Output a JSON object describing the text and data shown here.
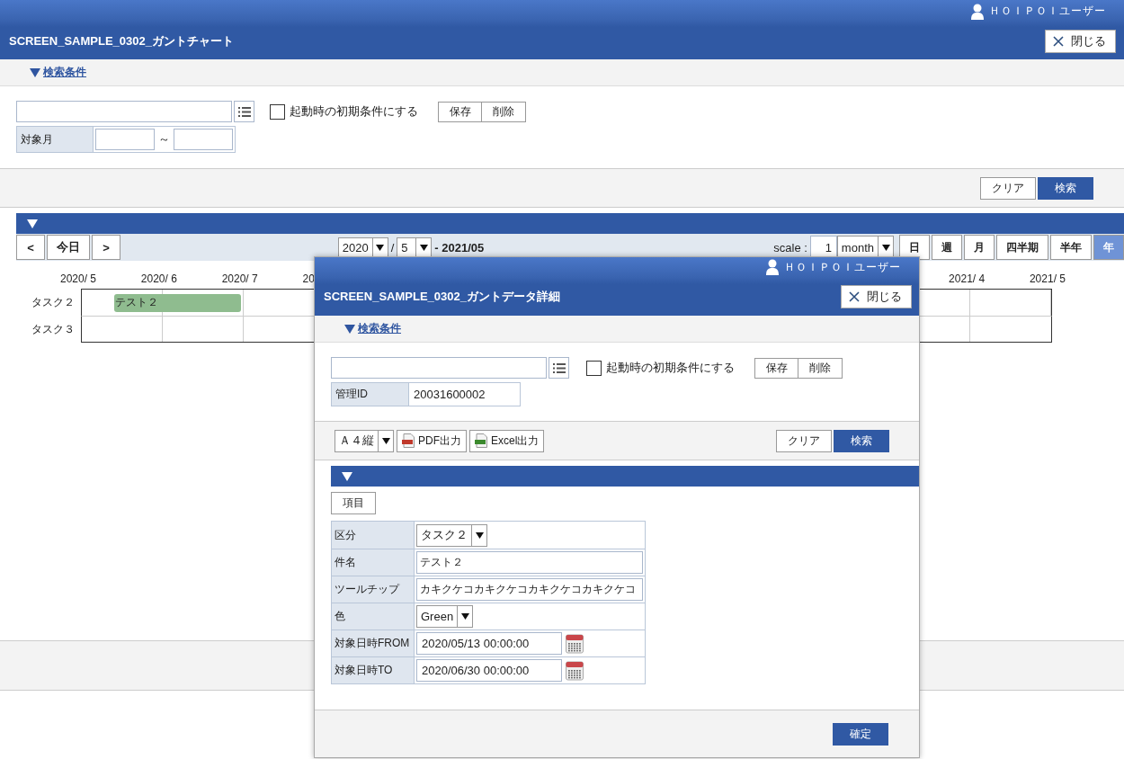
{
  "header": {
    "user": "ＨＯＩＰＯＩユーザー",
    "title": "SCREEN_SAMPLE_0302_ガントチャート",
    "close": "閉じる"
  },
  "search": {
    "label": "検索条件",
    "expanded": true
  },
  "preset": {
    "label": "起動時の初期条件にする",
    "checked": false,
    "buttons": [
      "保存",
      "削除"
    ]
  },
  "filter": {
    "label": "対象月",
    "separator": "～"
  },
  "actions": [
    {
      "label": "クリア",
      "primary": false
    },
    {
      "label": "検索",
      "primary": true
    }
  ],
  "gantt": {
    "nav": [
      "<",
      "今日",
      ">"
    ],
    "year": "2020",
    "slash": "/",
    "month": "5",
    "to": "- 2021/05",
    "scale_label": "scale :",
    "scale_value": "1",
    "scale_unit": "month",
    "scale_buttons": [
      {
        "label": "日",
        "selected": false
      },
      {
        "label": "週",
        "selected": false
      },
      {
        "label": "月",
        "selected": false
      },
      {
        "label": "四半期",
        "selected": false
      },
      {
        "label": "半年",
        "selected": false
      },
      {
        "label": "年",
        "selected": true
      }
    ],
    "timeline": {
      "start": [
        "2020/ 5",
        "2020/ 6",
        "2020/ 7",
        "20"
      ],
      "end": [
        "2021/ 4",
        "2021/ 5"
      ]
    },
    "rows": [
      {
        "label": "タスク２",
        "bar": "テスト２"
      },
      {
        "label": "タスク３"
      }
    ]
  },
  "modal": {
    "user": "ＨＯＩＰＯＩユーザー",
    "title": "SCREEN_SAMPLE_0302_ガントデータ詳細",
    "close": "閉じる",
    "search": {
      "label": "検索条件",
      "expanded": true
    },
    "preset": {
      "label": "起動時の初期条件にする",
      "checked": false,
      "buttons": [
        "保存",
        "削除"
      ]
    },
    "id_label": "管理ID",
    "id_value": "20031600002",
    "paper": "Ａ４縦",
    "exports": [
      {
        "kind": "pdf",
        "label": "PDF出力"
      },
      {
        "kind": "excel",
        "label": "Excel出力"
      }
    ],
    "actions": [
      {
        "label": "クリア",
        "primary": false
      },
      {
        "label": "検索",
        "primary": true
      }
    ],
    "items_button": "項目",
    "fields": [
      {
        "kind": "select",
        "label": "区分",
        "value": "タスク２"
      },
      {
        "kind": "text",
        "label": "件名",
        "value": "テスト２"
      },
      {
        "kind": "text",
        "label": "ツールチップ",
        "value": "カキクケコカキクケコカキクケコカキクケコ"
      },
      {
        "kind": "select",
        "label": "色",
        "value": "Green"
      },
      {
        "kind": "date",
        "label": "対象日時FROM",
        "value": "2020/05/13 00:00:00"
      },
      {
        "kind": "date",
        "label": "対象日時TO",
        "value": "2020/06/30 00:00:00"
      }
    ],
    "confirm": "確定"
  }
}
